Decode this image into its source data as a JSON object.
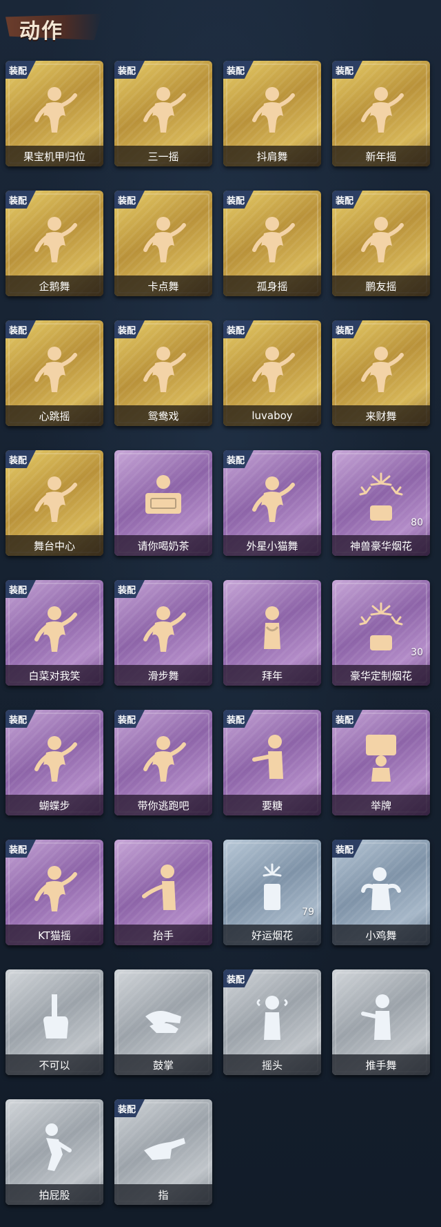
{
  "page": {
    "title": "动作",
    "equip_label": "装配"
  },
  "colors": {
    "gold": "#d2b048",
    "purple": "#9c78b8",
    "blue": "#8fa3b8",
    "grey": "#aab0b6",
    "badge": "#2c3e63"
  },
  "actions": [
    {
      "name": "果宝机甲归位",
      "rarity": "gold",
      "equipped": true,
      "icon": "dance-pose-icon"
    },
    {
      "name": "三一摇",
      "rarity": "gold",
      "equipped": true,
      "icon": "dance-pose-icon"
    },
    {
      "name": "抖肩舞",
      "rarity": "gold",
      "equipped": true,
      "icon": "dance-pose-icon"
    },
    {
      "name": "新年摇",
      "rarity": "gold",
      "equipped": true,
      "icon": "dance-pose-icon"
    },
    {
      "name": "企鹅舞",
      "rarity": "gold",
      "equipped": true,
      "icon": "dance-pose-icon"
    },
    {
      "name": "卡点舞",
      "rarity": "gold",
      "equipped": true,
      "icon": "dance-pose-icon"
    },
    {
      "name": "孤身摇",
      "rarity": "gold",
      "equipped": true,
      "icon": "dance-pose-icon"
    },
    {
      "name": "鹏友摇",
      "rarity": "gold",
      "equipped": true,
      "icon": "dance-pose-icon"
    },
    {
      "name": "心跳摇",
      "rarity": "gold",
      "equipped": true,
      "icon": "dance-pose-icon"
    },
    {
      "name": "鸳鸯戏",
      "rarity": "gold",
      "equipped": true,
      "icon": "dance-pose-icon"
    },
    {
      "name": "luvaboy",
      "rarity": "gold",
      "equipped": true,
      "icon": "dance-pose-icon"
    },
    {
      "name": "来财舞",
      "rarity": "gold",
      "equipped": true,
      "icon": "dance-pose-icon"
    },
    {
      "name": "舞台中心",
      "rarity": "gold",
      "equipped": true,
      "icon": "dance-pose-icon"
    },
    {
      "name": "请你喝奶茶",
      "rarity": "purple",
      "equipped": false,
      "icon": "milk-tea-sign-icon"
    },
    {
      "name": "外星小猫舞",
      "rarity": "purple",
      "equipped": true,
      "icon": "dance-pose-icon"
    },
    {
      "name": "神兽豪华烟花",
      "rarity": "purple",
      "equipped": false,
      "icon": "fireworks-icon",
      "count": "80"
    },
    {
      "name": "白菜对我笑",
      "rarity": "purple",
      "equipped": true,
      "icon": "dance-pose-icon"
    },
    {
      "name": "滑步舞",
      "rarity": "purple",
      "equipped": true,
      "icon": "dance-pose-icon"
    },
    {
      "name": "拜年",
      "rarity": "purple",
      "equipped": false,
      "icon": "bow-pose-icon"
    },
    {
      "name": "豪华定制烟花",
      "rarity": "purple",
      "equipped": false,
      "icon": "fireworks-icon",
      "count": "30"
    },
    {
      "name": "蝴蝶步",
      "rarity": "purple",
      "equipped": true,
      "icon": "dance-pose-icon"
    },
    {
      "name": "带你逃跑吧",
      "rarity": "purple",
      "equipped": true,
      "icon": "dance-pose-icon"
    },
    {
      "name": "要糖",
      "rarity": "purple",
      "equipped": true,
      "icon": "candy-ask-icon"
    },
    {
      "name": "举牌",
      "rarity": "purple",
      "equipped": true,
      "icon": "hold-sign-icon"
    },
    {
      "name": "KT猫摇",
      "rarity": "purple",
      "equipped": true,
      "icon": "dance-pose-icon"
    },
    {
      "name": "抬手",
      "rarity": "purple",
      "equipped": false,
      "icon": "raise-hand-icon"
    },
    {
      "name": "好运烟花",
      "rarity": "blue",
      "equipped": false,
      "icon": "firework-can-icon",
      "count": "79"
    },
    {
      "name": "小鸡舞",
      "rarity": "blue",
      "equipped": true,
      "icon": "chicken-dance-icon"
    },
    {
      "name": "不可以",
      "rarity": "grey",
      "equipped": false,
      "icon": "finger-wag-icon"
    },
    {
      "name": "鼓掌",
      "rarity": "grey",
      "equipped": false,
      "icon": "clap-icon"
    },
    {
      "name": "摇头",
      "rarity": "grey",
      "equipped": true,
      "icon": "head-shake-icon"
    },
    {
      "name": "推手舞",
      "rarity": "grey",
      "equipped": false,
      "icon": "push-hand-icon"
    },
    {
      "name": "拍屁股",
      "rarity": "grey",
      "equipped": false,
      "icon": "butt-pat-icon"
    },
    {
      "name": "指",
      "rarity": "grey",
      "equipped": true,
      "icon": "point-icon"
    }
  ]
}
